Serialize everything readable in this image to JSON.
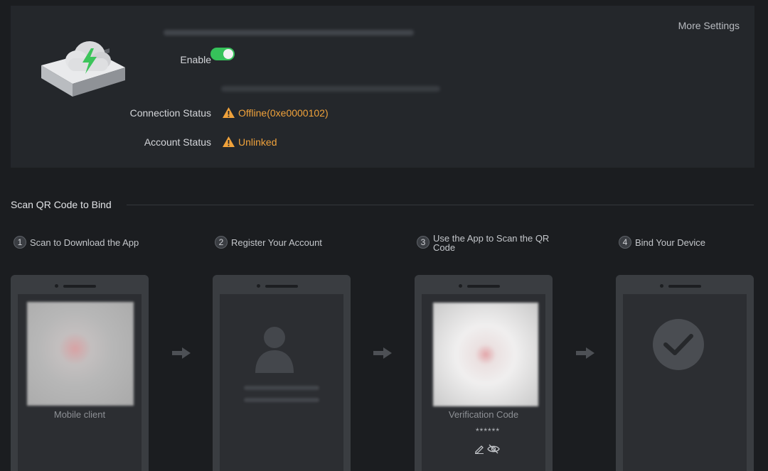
{
  "header": {
    "more_settings": "More Settings",
    "enable_label": "Enable",
    "enable_state": true,
    "connection_status_label": "Connection Status",
    "connection_status_value": "Offline(0xe0000102)",
    "account_status_label": "Account Status",
    "account_status_value": "Unlinked"
  },
  "section": {
    "title": "Scan QR Code to Bind"
  },
  "steps": [
    {
      "num": "1",
      "label": "Scan to Download the App"
    },
    {
      "num": "2",
      "label": "Register Your Account"
    },
    {
      "num": "3",
      "label": "Use the App to Scan the QR Code"
    },
    {
      "num": "4",
      "label": "Bind Your Device"
    }
  ],
  "phones": {
    "mobile_caption": "Mobile client",
    "verification_caption": "Verification Code",
    "verification_code": "******"
  },
  "colors": {
    "accent_green": "#36c25a",
    "warning_orange": "#f0a23b"
  }
}
